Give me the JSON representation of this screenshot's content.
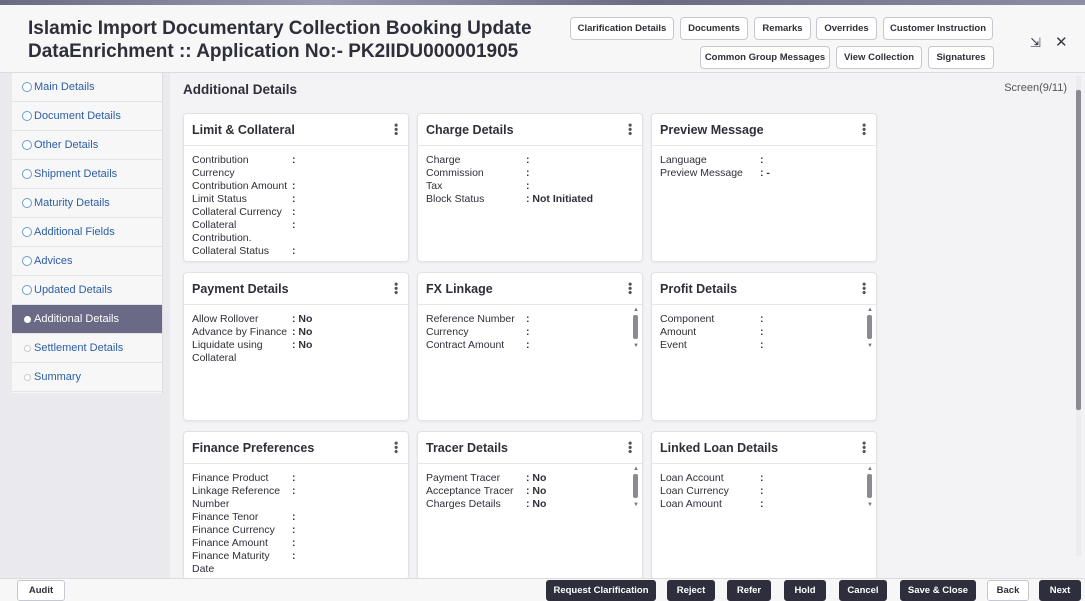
{
  "header": {
    "title_line1": "Islamic Import Documentary Collection Booking Update",
    "title_line2": "DataEnrichment :: Application No:- PK2IIDU000001905",
    "buttons": {
      "clarification_details": "Clarification Details",
      "documents": "Documents",
      "remarks": "Remarks",
      "overrides": "Overrides",
      "customer_instruction": "Customer Instruction",
      "common_group_messages": "Common Group Messages",
      "view_collection": "View Collection",
      "signatures": "Signatures"
    },
    "icons": {
      "minimize": "collapse-icon",
      "close": "close-icon"
    },
    "close_glyph": "✕",
    "collapse_glyph": "⇲"
  },
  "sidebar": {
    "items": [
      {
        "label": "Main Details",
        "state": "done"
      },
      {
        "label": "Document Details",
        "state": "done"
      },
      {
        "label": "Other Details",
        "state": "done"
      },
      {
        "label": "Shipment Details",
        "state": "done"
      },
      {
        "label": "Maturity Details",
        "state": "done"
      },
      {
        "label": "Additional Fields",
        "state": "done"
      },
      {
        "label": "Advices",
        "state": "done"
      },
      {
        "label": "Updated Details",
        "state": "done"
      },
      {
        "label": "Additional Details",
        "state": "active"
      },
      {
        "label": "Settlement Details",
        "state": "pending"
      },
      {
        "label": "Summary",
        "state": "pending"
      }
    ]
  },
  "main": {
    "title": "Additional Details",
    "screen": "Screen(9/11)"
  },
  "cards": {
    "limit_collateral": {
      "title": "Limit & Collateral",
      "rows": [
        {
          "label": "Contribution Currency",
          "value": ""
        },
        {
          "label": "Contribution Amount",
          "value": ""
        },
        {
          "label": "Limit Status",
          "value": ""
        },
        {
          "label": "Collateral Currency",
          "value": ""
        },
        {
          "label": "Collateral Contribution.",
          "value": ""
        },
        {
          "label": "Collateral Status",
          "value": ""
        }
      ]
    },
    "charge_details": {
      "title": "Charge Details",
      "rows": [
        {
          "label": "Charge",
          "value": ""
        },
        {
          "label": "Commission",
          "value": ""
        },
        {
          "label": "Tax",
          "value": ""
        },
        {
          "label": "Block Status",
          "value": "Not Initiated"
        }
      ]
    },
    "preview_message": {
      "title": "Preview Message",
      "rows": [
        {
          "label": "Language",
          "value": ""
        },
        {
          "label": "Preview Message",
          "value": "-"
        }
      ]
    },
    "payment_details": {
      "title": "Payment Details",
      "rows": [
        {
          "label": "Allow Rollover",
          "value": "No"
        },
        {
          "label": "Advance by Finance",
          "value": "No"
        },
        {
          "label": "Liquidate using Collateral",
          "value": "No"
        }
      ]
    },
    "fx_linkage": {
      "title": "FX Linkage",
      "rows": [
        {
          "label": "Reference Number",
          "value": ""
        },
        {
          "label": "Currency",
          "value": ""
        },
        {
          "label": "Contract Amount",
          "value": ""
        }
      ]
    },
    "profit_details": {
      "title": "Profit Details",
      "rows": [
        {
          "label": "Component",
          "value": ""
        },
        {
          "label": "Amount",
          "value": ""
        },
        {
          "label": "Event",
          "value": ""
        }
      ]
    },
    "finance_preferences": {
      "title": "Finance Preferences",
      "rows": [
        {
          "label": "Finance Product",
          "value": ""
        },
        {
          "label": "Linkage Reference Number",
          "value": ""
        },
        {
          "label": "Finance Tenor",
          "value": ""
        },
        {
          "label": "Finance Currency",
          "value": ""
        },
        {
          "label": "Finance Amount",
          "value": ""
        },
        {
          "label": "Finance Maturity Date",
          "value": ""
        }
      ]
    },
    "tracer_details": {
      "title": "Tracer Details",
      "rows": [
        {
          "label": "Payment Tracer",
          "value": "No"
        },
        {
          "label": "Acceptance Tracer",
          "value": "No"
        },
        {
          "label": "Charges Details",
          "value": "No"
        }
      ]
    },
    "linked_loan_details": {
      "title": "Linked Loan Details",
      "rows": [
        {
          "label": "Loan Account",
          "value": ""
        },
        {
          "label": "Loan Currency",
          "value": ""
        },
        {
          "label": "Loan Amount",
          "value": ""
        }
      ]
    }
  },
  "footer": {
    "audit": "Audit",
    "request_clarification": "Request Clarification",
    "reject": "Reject",
    "refer": "Refer",
    "hold": "Hold",
    "cancel": "Cancel",
    "save_close": "Save & Close",
    "back": "Back",
    "next": "Next"
  },
  "colors": {
    "active_nav": "#6a6a86",
    "dark_button": "#2e2e3c",
    "link_blue": "#2c5ea3"
  }
}
